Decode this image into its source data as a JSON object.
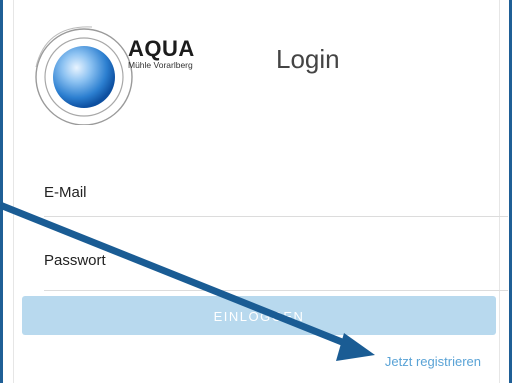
{
  "logo": {
    "title": "AQUA",
    "subtitle": "Mühle Vorarlberg"
  },
  "header": {
    "title": "Login"
  },
  "form": {
    "email_label": "E-Mail",
    "email_value": "",
    "password_label": "Passwort",
    "password_value": "",
    "submit_label": "EINLOGGEN"
  },
  "register_link": "Jetzt registrieren",
  "colors": {
    "frame": "#1f5f96",
    "button": "#b8d9ee",
    "link": "#5aa3d6",
    "annotation_arrow": "#1a5c94"
  },
  "icons": {
    "logo_mark": "blue-sphere-with-concentric-rings",
    "annotation": "arrow-pointing-to-register-link"
  }
}
